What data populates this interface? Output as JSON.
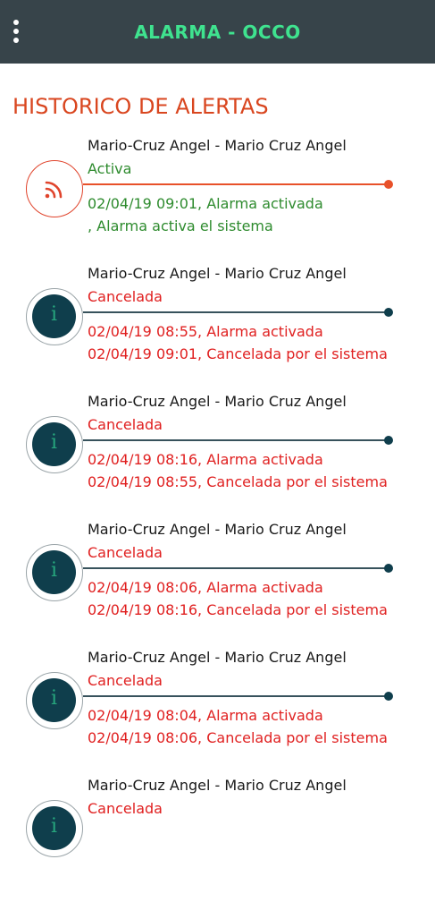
{
  "app": {
    "title": "ALARMA - OCCO",
    "menu_icon": "more-vert-icon"
  },
  "section_title": "HISTORICO DE ALERTAS",
  "colors": {
    "appbar": "#37444a",
    "title": "#3fe38f",
    "section_title": "#d9461f",
    "active": "#2e8b2e",
    "cancelled": "#e02020",
    "active_line": "#e8512a",
    "info_line": "#37525c",
    "info_icon_bg": "#0f3e4c"
  },
  "alerts": [
    {
      "icon": "alarm-signal-icon",
      "name": "Mario-Cruz Angel - Mario Cruz Angel",
      "status": "Activa",
      "line1": "02/04/19 09:01, Alarma activada",
      "line2": ", Alarma activa el sistema"
    },
    {
      "icon": "info-icon",
      "name": "Mario-Cruz Angel - Mario Cruz Angel",
      "status": "Cancelada",
      "line1": "02/04/19 08:55, Alarma activada",
      "line2": "02/04/19 09:01, Cancelada por  el sistema"
    },
    {
      "icon": "info-icon",
      "name": "Mario-Cruz Angel - Mario Cruz Angel",
      "status": "Cancelada",
      "line1": "02/04/19 08:16, Alarma activada",
      "line2": "02/04/19 08:55, Cancelada por  el sistema"
    },
    {
      "icon": "info-icon",
      "name": "Mario-Cruz Angel - Mario Cruz Angel",
      "status": "Cancelada",
      "line1": "02/04/19 08:06, Alarma activada",
      "line2": "02/04/19 08:16, Cancelada por  el sistema"
    },
    {
      "icon": "info-icon",
      "name": "Mario-Cruz Angel - Mario Cruz Angel",
      "status": "Cancelada",
      "line1": "02/04/19 08:04, Alarma activada",
      "line2": "02/04/19 08:06, Cancelada por  el sistema"
    },
    {
      "icon": "info-icon",
      "name": "Mario-Cruz Angel - Mario Cruz Angel",
      "status": "Cancelada",
      "line1": "",
      "line2": ""
    }
  ]
}
